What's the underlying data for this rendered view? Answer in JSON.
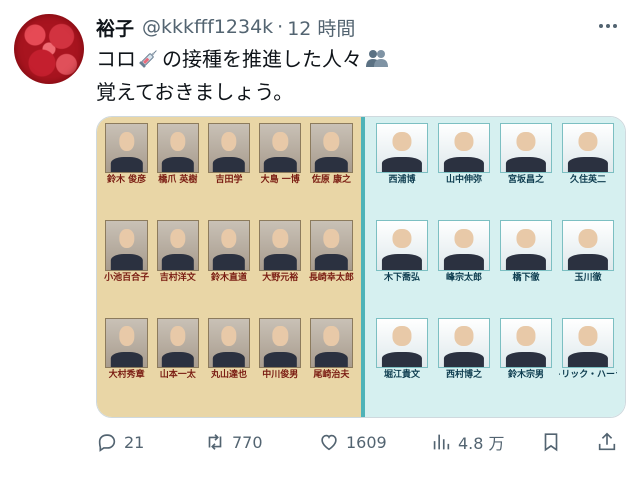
{
  "author": {
    "name": "裕子",
    "handle": "@kkkfff1234k",
    "separator": "·",
    "time": "12 時間"
  },
  "tweet": {
    "line1_before": "コロ",
    "line1_after": "の接種を推進した人々",
    "line2": "覚えておきましょう。"
  },
  "icons": {
    "syringe": "syringe-icon",
    "people": "people-icon",
    "reply": "reply-icon",
    "retweet": "retweet-icon",
    "like": "heart-icon",
    "views": "views-icon",
    "bookmark": "bookmark-icon",
    "more": "more-icon"
  },
  "media": {
    "left_captions": [
      "鈴木 俊彦",
      "橋爪 英樹",
      "吉田学",
      "大島 一博",
      "佐原 康之",
      "小池百合子",
      "吉村洋文",
      "鈴木直道",
      "大野元裕",
      "長崎幸太郎",
      "大村秀章",
      "山本一太",
      "丸山達也",
      "中川俊男",
      "尾崎治夫"
    ],
    "right_captions": [
      "西浦博",
      "山中伸弥",
      "宮坂昌之",
      "久住英二",
      "木下喬弘",
      "峰宗太郎",
      "橋下徹",
      "玉川徹",
      "堀江貴文",
      "西村博之",
      "鈴木宗男",
      "パトリック・ハーラン"
    ]
  },
  "stats": {
    "replies": "21",
    "retweets": "770",
    "likes": "1609",
    "views": "4.8 万"
  },
  "colors": {
    "text": "#0f1419",
    "secondary": "#536471",
    "border": "#cfd9de"
  }
}
